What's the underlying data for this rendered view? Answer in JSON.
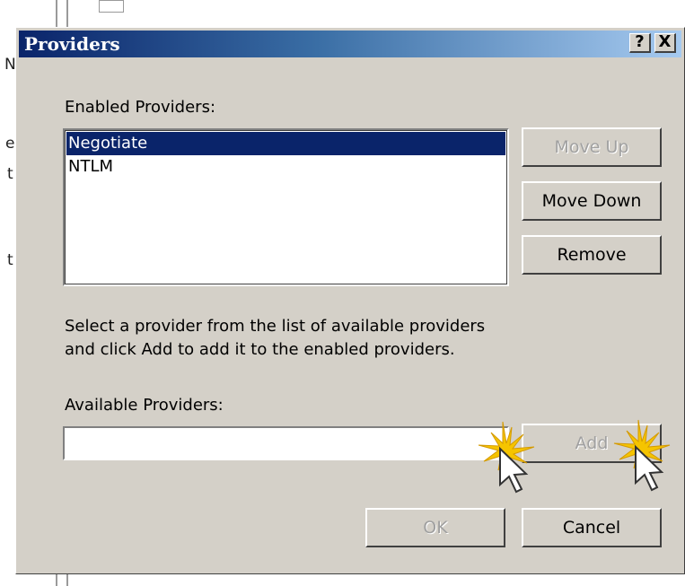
{
  "dialog": {
    "title": "Providers",
    "help_label": "?",
    "close_label": "X"
  },
  "enabled": {
    "label": "Enabled Providers:",
    "items": [
      {
        "label": "Negotiate",
        "selected": true
      },
      {
        "label": "NTLM",
        "selected": false
      }
    ]
  },
  "buttons": {
    "move_up": "Move Up",
    "move_down": "Move Down",
    "remove": "Remove",
    "add": "Add",
    "ok": "OK",
    "cancel": "Cancel"
  },
  "instructions": {
    "line1": "Select a provider from the list of available providers",
    "line2": "and click Add to add it to the enabled providers."
  },
  "available": {
    "label": "Available Providers:",
    "value": ""
  },
  "background": {
    "frag1": "N",
    "frag2": "e",
    "frag3": "t",
    "frag4": "t"
  },
  "colors": {
    "title_start": "#0a246a",
    "title_end": "#a6caf0",
    "dialog_face": "#d4d0c8",
    "selection": "#0a246a"
  }
}
